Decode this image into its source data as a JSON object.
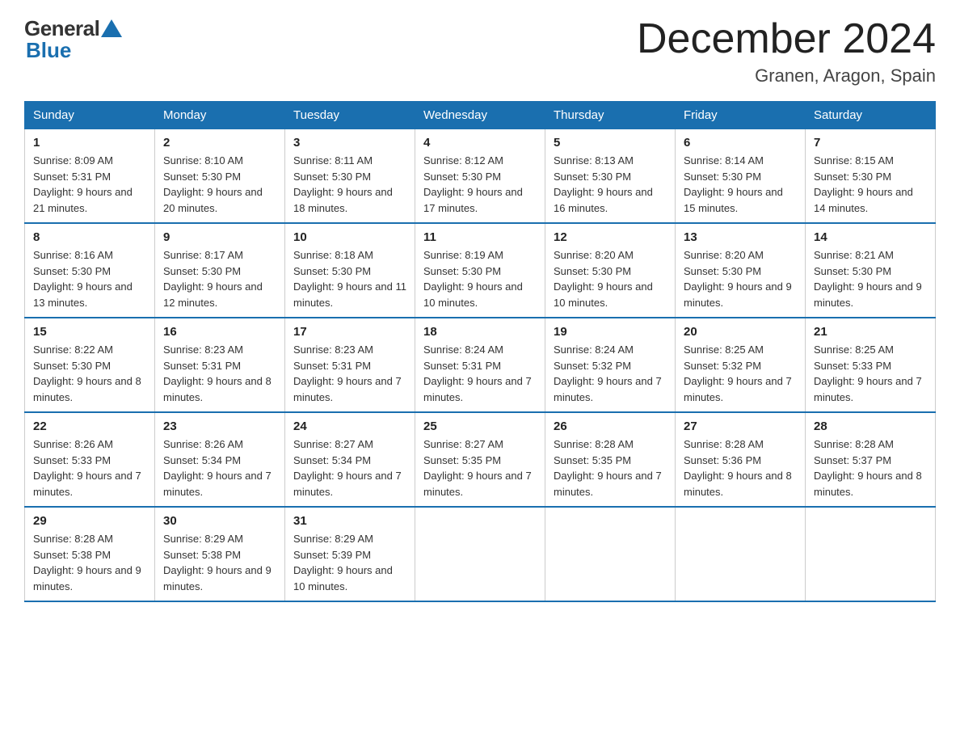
{
  "header": {
    "logo_general": "General",
    "logo_blue": "Blue",
    "month_title": "December 2024",
    "location": "Granen, Aragon, Spain"
  },
  "weekdays": [
    "Sunday",
    "Monday",
    "Tuesday",
    "Wednesday",
    "Thursday",
    "Friday",
    "Saturday"
  ],
  "weeks": [
    [
      {
        "day": "1",
        "sunrise": "8:09 AM",
        "sunset": "5:31 PM",
        "daylight": "9 hours and 21 minutes."
      },
      {
        "day": "2",
        "sunrise": "8:10 AM",
        "sunset": "5:30 PM",
        "daylight": "9 hours and 20 minutes."
      },
      {
        "day": "3",
        "sunrise": "8:11 AM",
        "sunset": "5:30 PM",
        "daylight": "9 hours and 18 minutes."
      },
      {
        "day": "4",
        "sunrise": "8:12 AM",
        "sunset": "5:30 PM",
        "daylight": "9 hours and 17 minutes."
      },
      {
        "day": "5",
        "sunrise": "8:13 AM",
        "sunset": "5:30 PM",
        "daylight": "9 hours and 16 minutes."
      },
      {
        "day": "6",
        "sunrise": "8:14 AM",
        "sunset": "5:30 PM",
        "daylight": "9 hours and 15 minutes."
      },
      {
        "day": "7",
        "sunrise": "8:15 AM",
        "sunset": "5:30 PM",
        "daylight": "9 hours and 14 minutes."
      }
    ],
    [
      {
        "day": "8",
        "sunrise": "8:16 AM",
        "sunset": "5:30 PM",
        "daylight": "9 hours and 13 minutes."
      },
      {
        "day": "9",
        "sunrise": "8:17 AM",
        "sunset": "5:30 PM",
        "daylight": "9 hours and 12 minutes."
      },
      {
        "day": "10",
        "sunrise": "8:18 AM",
        "sunset": "5:30 PM",
        "daylight": "9 hours and 11 minutes."
      },
      {
        "day": "11",
        "sunrise": "8:19 AM",
        "sunset": "5:30 PM",
        "daylight": "9 hours and 10 minutes."
      },
      {
        "day": "12",
        "sunrise": "8:20 AM",
        "sunset": "5:30 PM",
        "daylight": "9 hours and 10 minutes."
      },
      {
        "day": "13",
        "sunrise": "8:20 AM",
        "sunset": "5:30 PM",
        "daylight": "9 hours and 9 minutes."
      },
      {
        "day": "14",
        "sunrise": "8:21 AM",
        "sunset": "5:30 PM",
        "daylight": "9 hours and 9 minutes."
      }
    ],
    [
      {
        "day": "15",
        "sunrise": "8:22 AM",
        "sunset": "5:30 PM",
        "daylight": "9 hours and 8 minutes."
      },
      {
        "day": "16",
        "sunrise": "8:23 AM",
        "sunset": "5:31 PM",
        "daylight": "9 hours and 8 minutes."
      },
      {
        "day": "17",
        "sunrise": "8:23 AM",
        "sunset": "5:31 PM",
        "daylight": "9 hours and 7 minutes."
      },
      {
        "day": "18",
        "sunrise": "8:24 AM",
        "sunset": "5:31 PM",
        "daylight": "9 hours and 7 minutes."
      },
      {
        "day": "19",
        "sunrise": "8:24 AM",
        "sunset": "5:32 PM",
        "daylight": "9 hours and 7 minutes."
      },
      {
        "day": "20",
        "sunrise": "8:25 AM",
        "sunset": "5:32 PM",
        "daylight": "9 hours and 7 minutes."
      },
      {
        "day": "21",
        "sunrise": "8:25 AM",
        "sunset": "5:33 PM",
        "daylight": "9 hours and 7 minutes."
      }
    ],
    [
      {
        "day": "22",
        "sunrise": "8:26 AM",
        "sunset": "5:33 PM",
        "daylight": "9 hours and 7 minutes."
      },
      {
        "day": "23",
        "sunrise": "8:26 AM",
        "sunset": "5:34 PM",
        "daylight": "9 hours and 7 minutes."
      },
      {
        "day": "24",
        "sunrise": "8:27 AM",
        "sunset": "5:34 PM",
        "daylight": "9 hours and 7 minutes."
      },
      {
        "day": "25",
        "sunrise": "8:27 AM",
        "sunset": "5:35 PM",
        "daylight": "9 hours and 7 minutes."
      },
      {
        "day": "26",
        "sunrise": "8:28 AM",
        "sunset": "5:35 PM",
        "daylight": "9 hours and 7 minutes."
      },
      {
        "day": "27",
        "sunrise": "8:28 AM",
        "sunset": "5:36 PM",
        "daylight": "9 hours and 8 minutes."
      },
      {
        "day": "28",
        "sunrise": "8:28 AM",
        "sunset": "5:37 PM",
        "daylight": "9 hours and 8 minutes."
      }
    ],
    [
      {
        "day": "29",
        "sunrise": "8:28 AM",
        "sunset": "5:38 PM",
        "daylight": "9 hours and 9 minutes."
      },
      {
        "day": "30",
        "sunrise": "8:29 AM",
        "sunset": "5:38 PM",
        "daylight": "9 hours and 9 minutes."
      },
      {
        "day": "31",
        "sunrise": "8:29 AM",
        "sunset": "5:39 PM",
        "daylight": "9 hours and 10 minutes."
      },
      null,
      null,
      null,
      null
    ]
  ]
}
